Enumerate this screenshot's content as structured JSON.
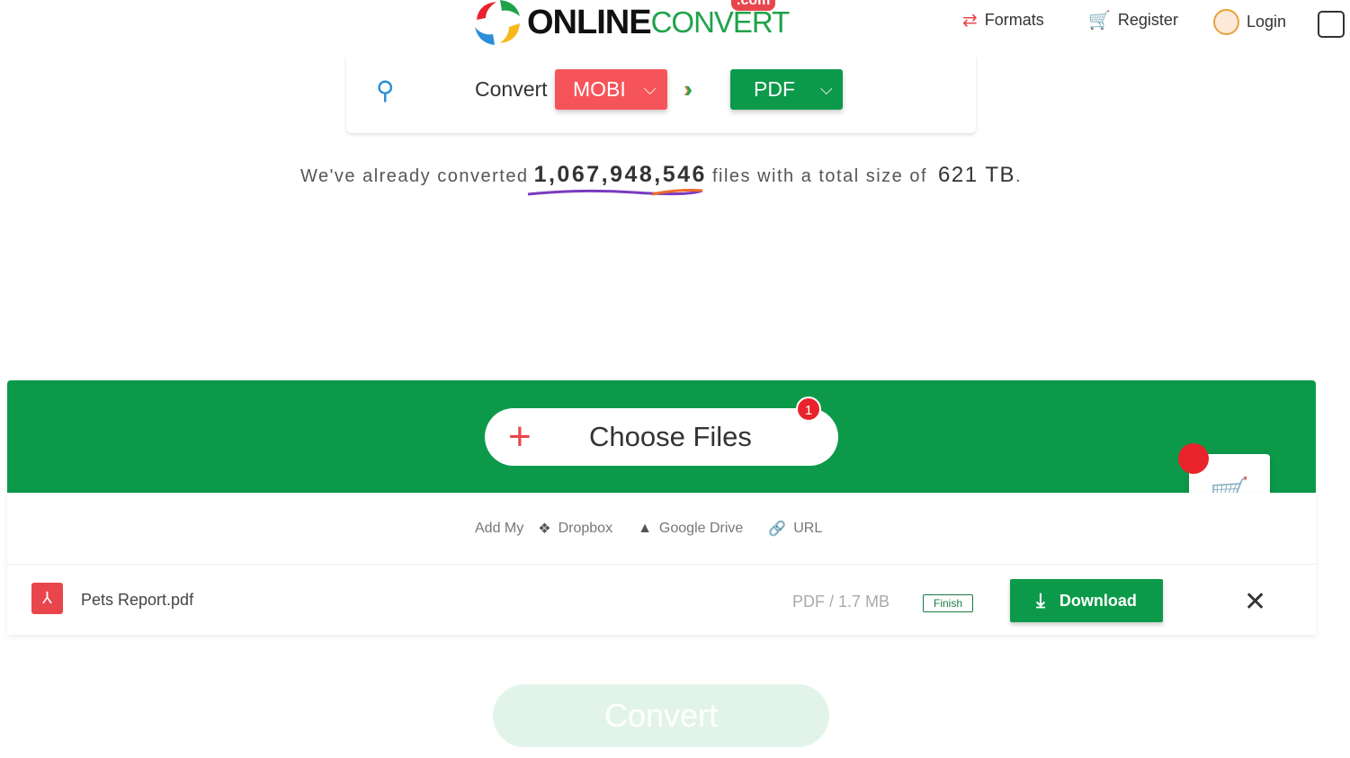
{
  "brand": {
    "name_bold": "ONLINE",
    "name_light": "CONVERT",
    "tld": ".com"
  },
  "nav": [
    {
      "label": "Formats",
      "icon": "formats-icon"
    },
    {
      "label": "Register",
      "icon": "cart-plus-icon"
    },
    {
      "label": "Login",
      "icon": "avatar-icon"
    }
  ],
  "converter": {
    "label": "Convert",
    "from": "MOBI",
    "to": "PDF",
    "from_color": "#f5555a",
    "to_color": "#0c9a4a"
  },
  "stats": {
    "prefix": "We've already converted",
    "count": "1,067,948,546",
    "middle": "files with a total size of",
    "size": "621 TB",
    "suffix": "."
  },
  "upload": {
    "choose_label": "Choose Files",
    "file_count": "1",
    "add_my": "Add My",
    "sources": [
      "Dropbox",
      "Google Drive",
      "URL"
    ]
  },
  "file": {
    "name": "Pets Report.pdf",
    "info": "PDF / 1.7 MB",
    "status": "Finish",
    "download_label": "Download"
  },
  "convert_label": "Convert"
}
